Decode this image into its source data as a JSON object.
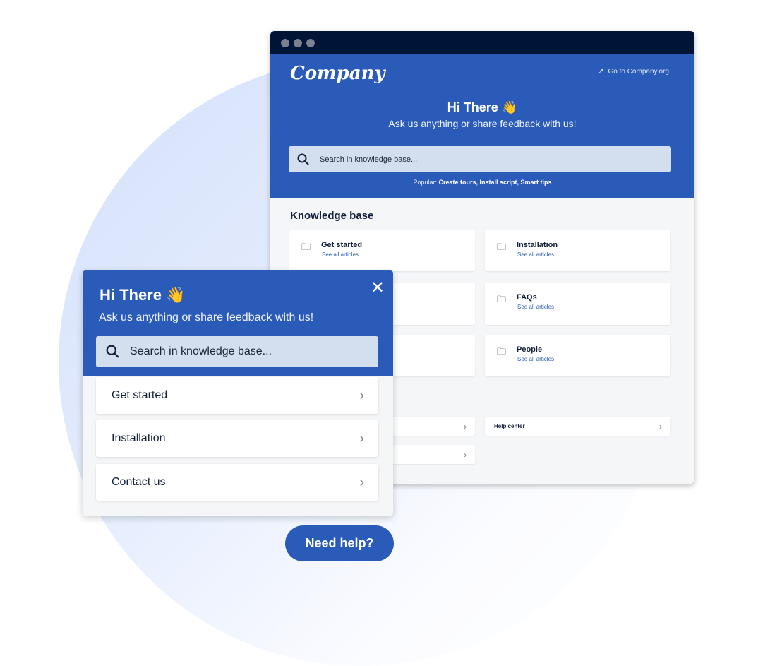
{
  "browser": {
    "logo": "Company",
    "external_link": "Go to Company.org",
    "greeting": "Hi There 👋",
    "subtitle": "Ask us anything or share feedback with us!",
    "search_placeholder": "Search in knowledge base...",
    "popular_label": "Popular:",
    "popular_links": "Create tours, Install script, Smart tips",
    "kb_title": "Knowledge base",
    "categories": [
      {
        "title": "Get started",
        "link": "See all articles"
      },
      {
        "title": "Installation",
        "link": "See all articles"
      },
      {
        "title": "",
        "link": ""
      },
      {
        "title": "FAQs",
        "link": "See all articles"
      },
      {
        "title": "",
        "link": ""
      },
      {
        "title": "People",
        "link": "See all articles"
      }
    ],
    "links": [
      "",
      "Help center",
      ""
    ]
  },
  "widget": {
    "greeting": "Hi There 👋",
    "subtitle": "Ask us anything or share feedback with us!",
    "search_placeholder": "Search in knowledge base...",
    "items": [
      "Get started",
      "Installation",
      "Contact us"
    ]
  },
  "launcher": {
    "label": "Need help?"
  },
  "colors": {
    "brand": "#2b5bb8",
    "titlebar": "#001437"
  }
}
